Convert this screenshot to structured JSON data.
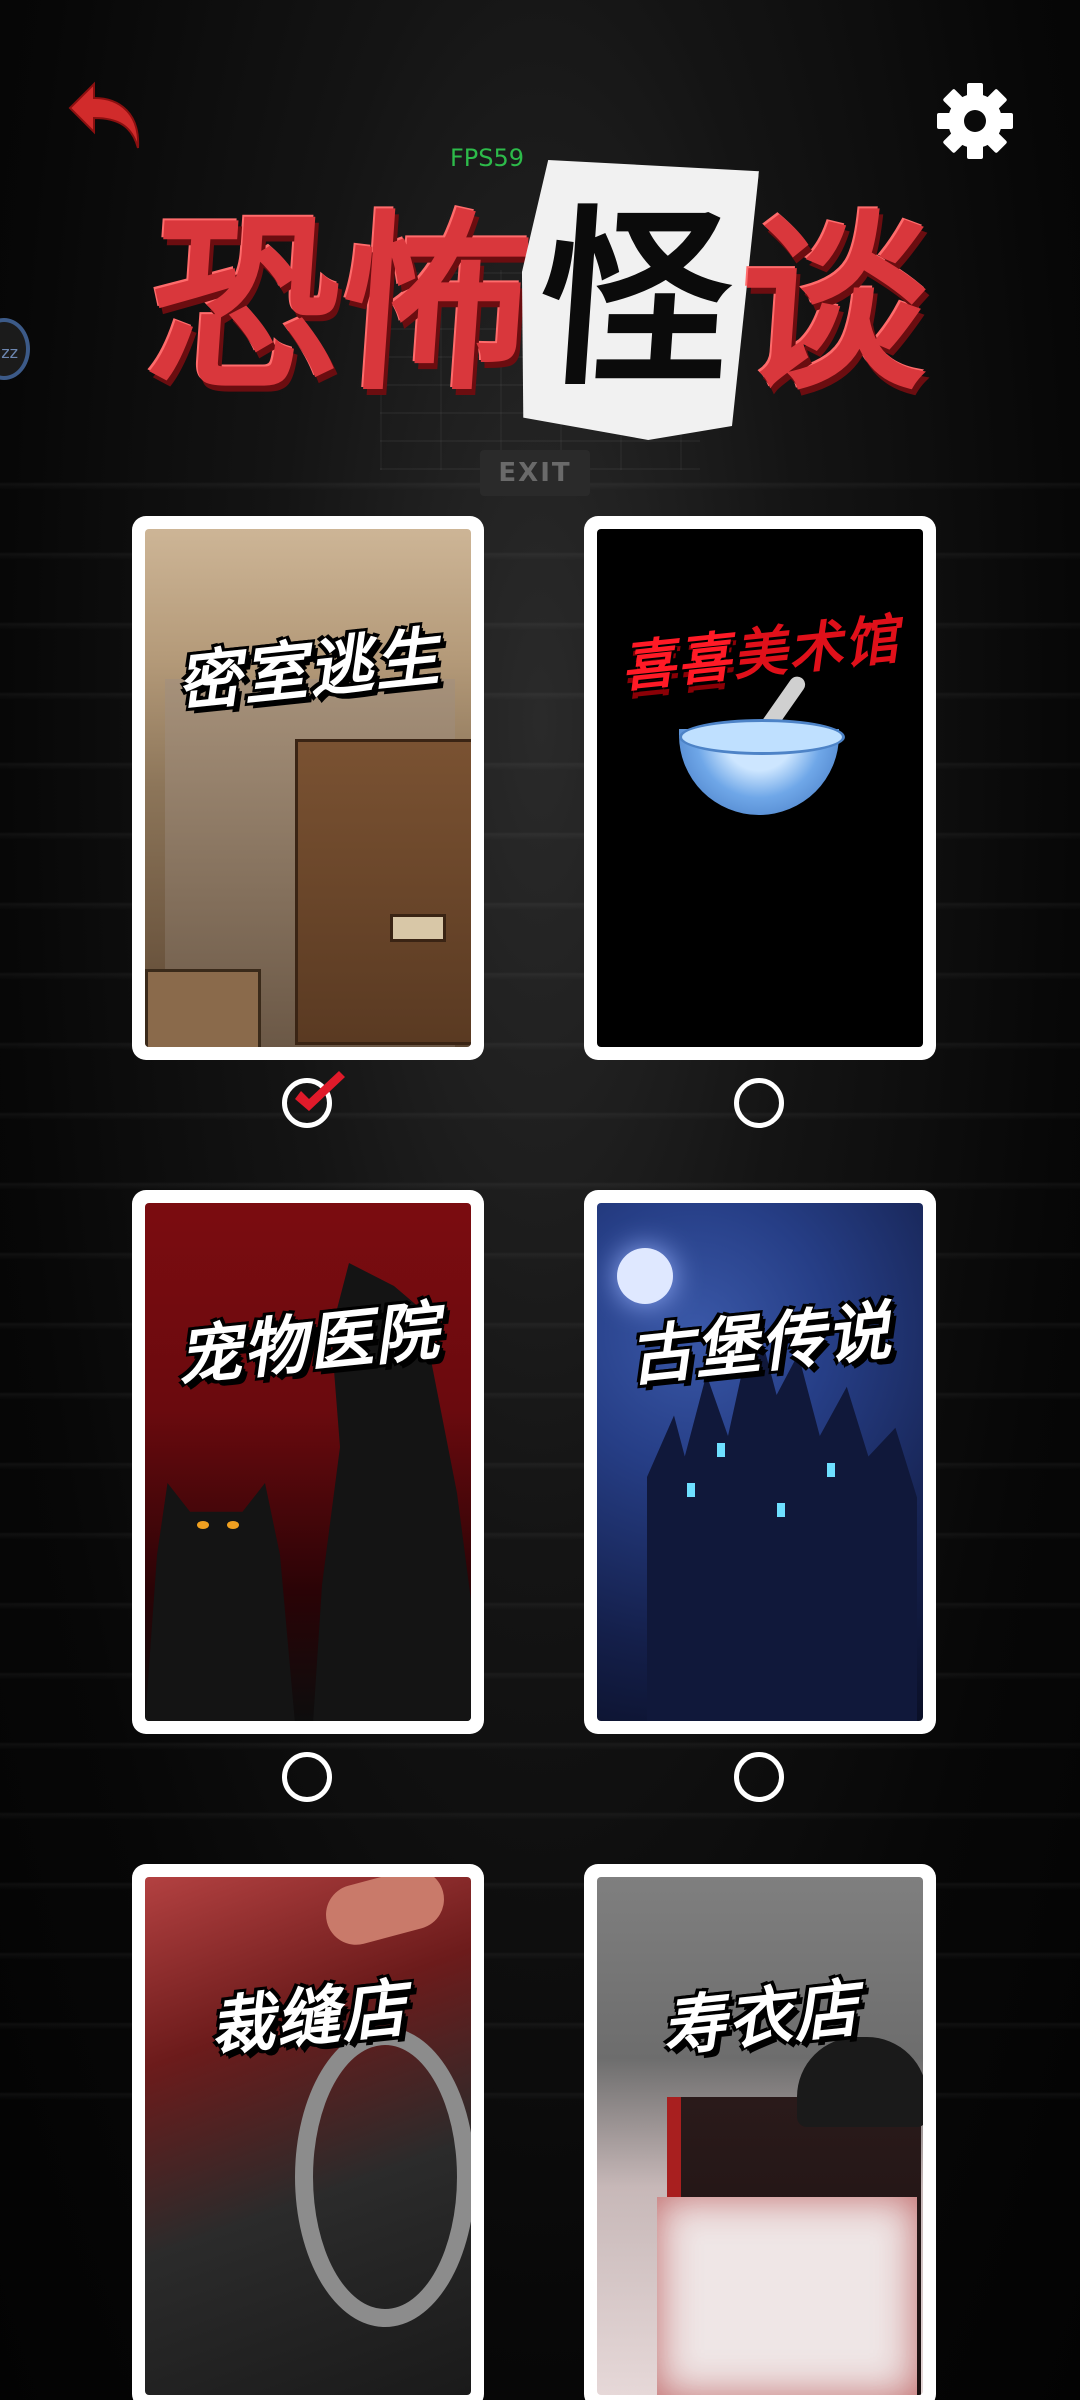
{
  "hud": {
    "fps": "FPS59",
    "side_bubble": "zz"
  },
  "title": {
    "chars": [
      "恐",
      "怖",
      "怪",
      "谈"
    ]
  },
  "icons": {
    "back": "back-arrow-icon",
    "settings": "gear-icon",
    "check": "checkmark-icon"
  },
  "background": {
    "exit_sign": "EXIT"
  },
  "colors": {
    "accent_red": "#d9373c",
    "fps_green": "#2dbb4a",
    "card_border": "#ffffff"
  },
  "levels": [
    {
      "label": "密室逃生",
      "selected": true
    },
    {
      "label_part1": "喜喜",
      "label_part2": "美术馆",
      "selected": false
    },
    {
      "label": "宠物医院",
      "selected": false
    },
    {
      "label": "古堡传说",
      "selected": false
    },
    {
      "label": "裁缝店",
      "selected": false
    },
    {
      "label": "寿衣店",
      "selected": false
    }
  ]
}
